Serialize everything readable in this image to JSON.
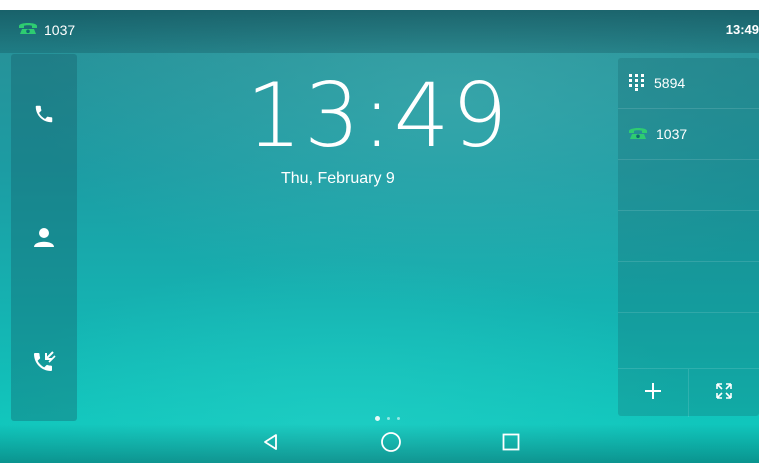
{
  "status_bar": {
    "account_number": "1037",
    "time": "13:49"
  },
  "clock": {
    "time": "13:49",
    "date": "Thu, February 9"
  },
  "left_panel": {
    "items": [
      {
        "icon": "phone-icon"
      },
      {
        "icon": "contact-icon"
      },
      {
        "icon": "call-history-icon"
      }
    ]
  },
  "right_panel": {
    "lines": [
      {
        "icon": "dialpad-icon",
        "label": "5894"
      },
      {
        "icon": "registered-line-icon",
        "label": "1037"
      }
    ],
    "bottom": [
      {
        "icon": "add-icon"
      },
      {
        "icon": "expand-icon"
      }
    ]
  },
  "page_indicator": {
    "pages": 3,
    "current": 1
  },
  "colors": {
    "registered_green": "#2ecc71",
    "text": "#ffffff"
  }
}
